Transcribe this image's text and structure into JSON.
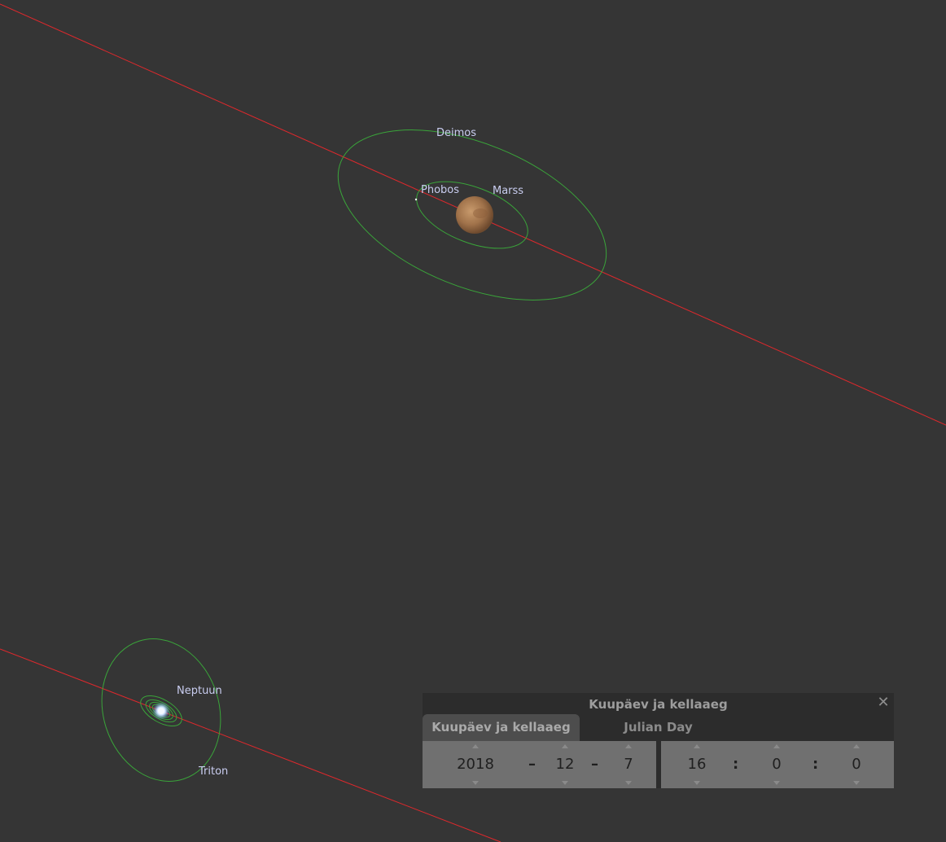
{
  "sky": {
    "background": "#353535",
    "ecliptic_color": "#e0282c",
    "orbit_color": "#3aa43a",
    "labels": {
      "deimos": "Deimos",
      "phobos": "Phobos",
      "mars": "Marss",
      "neptune": "Neptuun",
      "triton": "Triton"
    }
  },
  "dialog": {
    "title": "Kuupäev ja kellaaeg",
    "close_icon": "close-icon",
    "tabs": [
      "Kuupäev ja kellaaeg",
      "Julian Day"
    ],
    "active_tab": 0,
    "date": {
      "year": "2018",
      "month": "12",
      "day": "7",
      "separator": "–"
    },
    "time": {
      "hour": "16",
      "minute": "0",
      "second": "0",
      "separator": ":"
    }
  }
}
